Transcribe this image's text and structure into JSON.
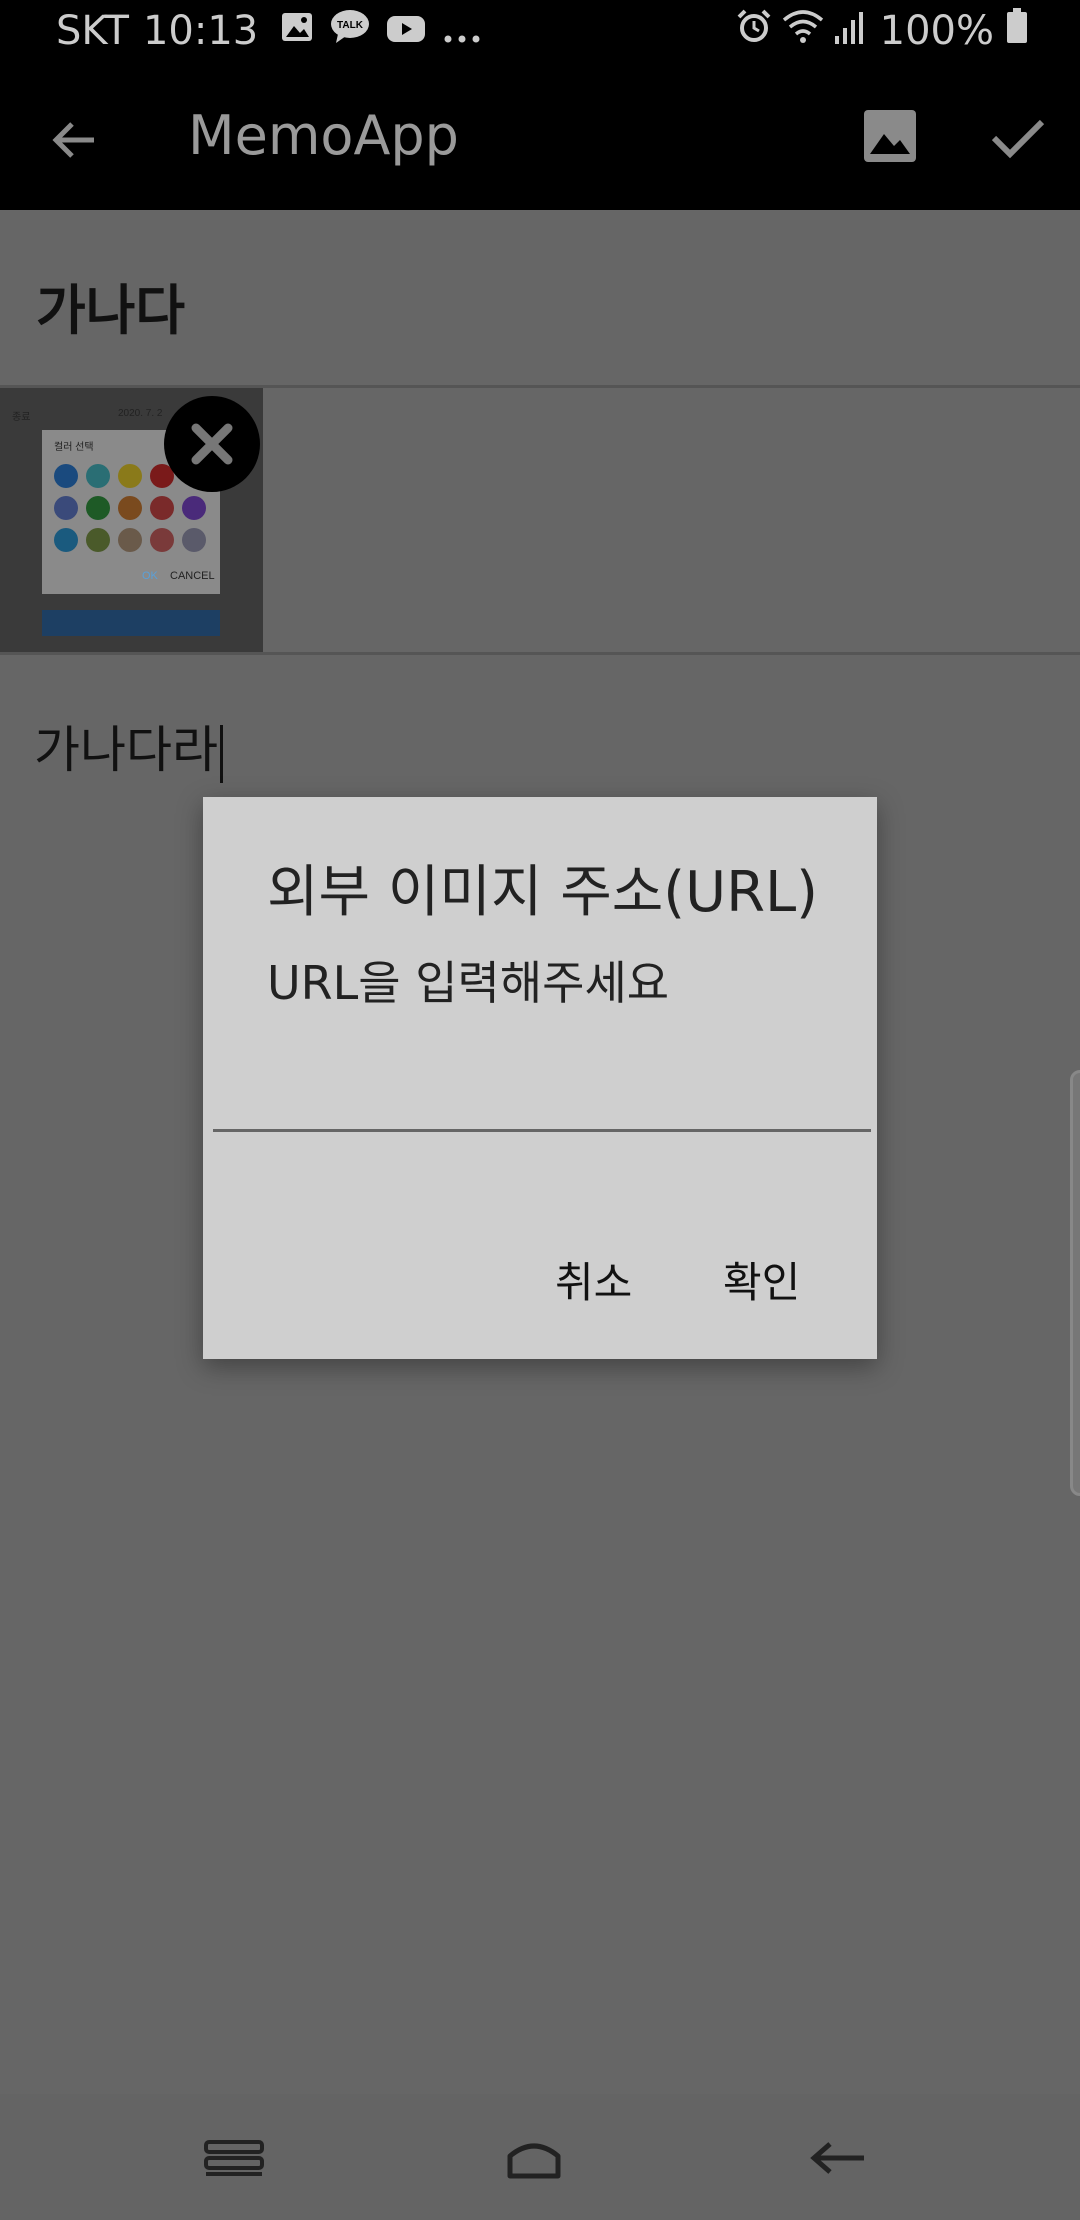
{
  "status_bar": {
    "carrier": "SKT",
    "time": "10:13",
    "notification_icons": [
      "gallery-icon",
      "kakaotalk-icon",
      "youtube-icon",
      "more-dots-icon"
    ],
    "kakaotalk_badge": "TALK",
    "system_icons": [
      "alarm-icon",
      "wifi-icon",
      "signal-icon",
      "battery-icon"
    ],
    "battery": "100%"
  },
  "app_bar": {
    "title": "MemoApp",
    "back_icon": "arrow-left-icon",
    "image_icon": "image-icon",
    "confirm_icon": "check-icon"
  },
  "memo": {
    "title": "가나다",
    "body": "가나다라",
    "attachment_thumbnail": {
      "header_left": "종료",
      "header_date": "2020. 7. 2",
      "dialog_label": "컬러 선택",
      "ok": "OK",
      "cancel": "CANCEL"
    }
  },
  "dialog": {
    "title": "외부 이미지 주소(URL)",
    "message": "URL을 입력해주세요",
    "input_value": "",
    "cancel_label": "취소",
    "ok_label": "확인"
  },
  "nav_bar": {
    "icons": [
      "recent-apps-icon",
      "home-icon",
      "back-icon"
    ]
  }
}
